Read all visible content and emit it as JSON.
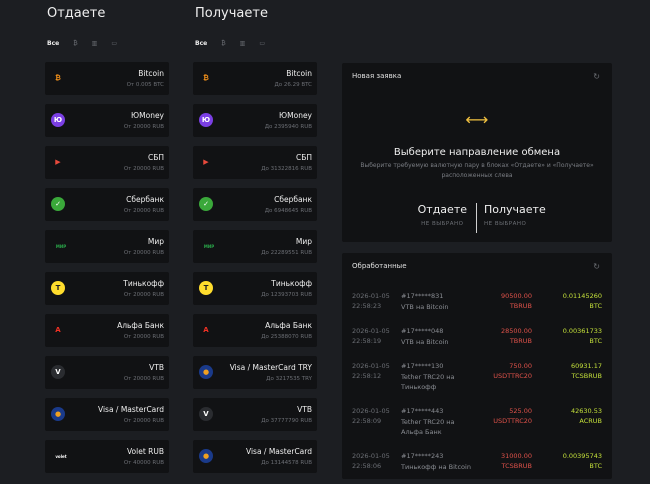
{
  "give": {
    "title": "Отдаете",
    "filters": [
      "Все",
      "₿",
      "▥",
      "▭"
    ],
    "items": [
      {
        "name": "Bitcoin",
        "sub": "От 0.005 BTC",
        "icon": "bitcoin-icon",
        "glyph": "₿",
        "color": "#f7931a",
        "bg": "transparent"
      },
      {
        "name": "ЮMoney",
        "sub": "От 20000 RUB",
        "icon": "yoomoney-icon",
        "glyph": "Ю",
        "color": "#ffffff",
        "bg": "#7b3fe4"
      },
      {
        "name": "СБП",
        "sub": "От 20000 RUB",
        "icon": "sbp-icon",
        "glyph": "▶",
        "color": "#e84a3c",
        "bg": "transparent"
      },
      {
        "name": "Сбербанк",
        "sub": "От 20000 RUB",
        "icon": "sberbank-icon",
        "glyph": "✓",
        "color": "#ffffff",
        "bg": "#3aa83a"
      },
      {
        "name": "Мир",
        "sub": "От 20000 RUB",
        "icon": "mir-icon",
        "glyph": "МИР",
        "color": "#2aa84a",
        "bg": "transparent"
      },
      {
        "name": "Тинькофф",
        "sub": "От 20000 RUB",
        "icon": "tinkoff-icon",
        "glyph": "T",
        "color": "#222222",
        "bg": "#ffdd2d"
      },
      {
        "name": "Альфа Банк",
        "sub": "От 20000 RUB",
        "icon": "alfabank-icon",
        "glyph": "А",
        "color": "#ef3124",
        "bg": "transparent"
      },
      {
        "name": "VTB",
        "sub": "От 20000 RUB",
        "icon": "vtb-icon",
        "glyph": "V",
        "color": "#ffffff",
        "bg": "#2a2c30"
      },
      {
        "name": "Visa / MasterCard",
        "sub": "От 20000 RUB",
        "icon": "visa-mastercard-icon",
        "glyph": "●",
        "color": "#f0a020",
        "bg": "#1a3a8a"
      },
      {
        "name": "Volet RUB",
        "sub": "От 40000 RUB",
        "icon": "volet-icon",
        "glyph": "volet",
        "color": "#ffffff",
        "bg": "transparent"
      }
    ]
  },
  "get": {
    "title": "Получаете",
    "filters": [
      "Все",
      "₿",
      "▥",
      "▭"
    ],
    "items": [
      {
        "name": "Bitcoin",
        "sub": "До 26.29 BTC",
        "icon": "bitcoin-icon",
        "glyph": "₿",
        "color": "#f7931a",
        "bg": "transparent"
      },
      {
        "name": "ЮMoney",
        "sub": "До 2395940 RUB",
        "icon": "yoomoney-icon",
        "glyph": "Ю",
        "color": "#ffffff",
        "bg": "#7b3fe4"
      },
      {
        "name": "СБП",
        "sub": "До 31322816 RUB",
        "icon": "sbp-icon",
        "glyph": "▶",
        "color": "#e84a3c",
        "bg": "transparent"
      },
      {
        "name": "Сбербанк",
        "sub": "До 6948645 RUB",
        "icon": "sberbank-icon",
        "glyph": "✓",
        "color": "#ffffff",
        "bg": "#3aa83a"
      },
      {
        "name": "Мир",
        "sub": "До 22289551 RUB",
        "icon": "mir-icon",
        "glyph": "МИР",
        "color": "#2aa84a",
        "bg": "transparent"
      },
      {
        "name": "Тинькофф",
        "sub": "До 12393703 RUB",
        "icon": "tinkoff-icon",
        "glyph": "T",
        "color": "#222222",
        "bg": "#ffdd2d"
      },
      {
        "name": "Альфа Банк",
        "sub": "До 25388070 RUB",
        "icon": "alfabank-icon",
        "glyph": "А",
        "color": "#ef3124",
        "bg": "transparent"
      },
      {
        "name": "Visa / MasterCard TRY",
        "sub": "До 3217535 TRY",
        "icon": "visa-mastercard-icon",
        "glyph": "●",
        "color": "#f0a020",
        "bg": "#1a3a8a"
      },
      {
        "name": "VTB",
        "sub": "До 37777790 RUB",
        "icon": "vtb-icon",
        "glyph": "V",
        "color": "#ffffff",
        "bg": "#2a2c30"
      },
      {
        "name": "Visa / MasterCard",
        "sub": "До 13144578 RUB",
        "icon": "visa-mastercard-icon",
        "glyph": "●",
        "color": "#f0a020",
        "bg": "#1a3a8a"
      }
    ]
  },
  "new_order": {
    "title": "Новая заявка",
    "heading": "Выберите направление обмена",
    "description": "Выберите требуемую валютную пару в блоках «Отдаете» и «Получаете» расположенных слева",
    "give_label": "Отдаете",
    "give_status": "НЕ ВЫБРАНО",
    "get_label": "Получаете",
    "get_status": "НЕ ВЫБРАНО"
  },
  "processed": {
    "title": "Обработанные",
    "orders": [
      {
        "date": "2026-01-05",
        "time": "22:58:23",
        "id": "#17*****831",
        "desc": "VTB на Bitcoin",
        "give_amount": "90500.00",
        "give_cur": "TBRUB",
        "get_amount": "0.01145260",
        "get_cur": "BTC"
      },
      {
        "date": "2026-01-05",
        "time": "22:58:19",
        "id": "#17*****048",
        "desc": "VTB на Bitcoin",
        "give_amount": "28500.00",
        "give_cur": "TBRUB",
        "get_amount": "0.00361733",
        "get_cur": "BTC"
      },
      {
        "date": "2026-01-05",
        "time": "22:58:12",
        "id": "#17*****130",
        "desc": "Tether TRC20 на Тинькофф",
        "give_amount": "750.00",
        "give_cur": "USDTTRC20",
        "get_amount": "60931.17",
        "get_cur": "TCSBRUB"
      },
      {
        "date": "2026-01-05",
        "time": "22:58:09",
        "id": "#17*****443",
        "desc": "Tether TRC20 на Альфа Банк",
        "give_amount": "525.00",
        "give_cur": "USDTTRC20",
        "get_amount": "42630.53",
        "get_cur": "ACRUB"
      },
      {
        "date": "2026-01-05",
        "time": "22:58:06",
        "id": "#17*****243",
        "desc": "Тинькофф на Bitcoin",
        "give_amount": "31000.00",
        "give_cur": "TCSBRUB",
        "get_amount": "0.00395743",
        "get_cur": "BTC"
      }
    ]
  }
}
